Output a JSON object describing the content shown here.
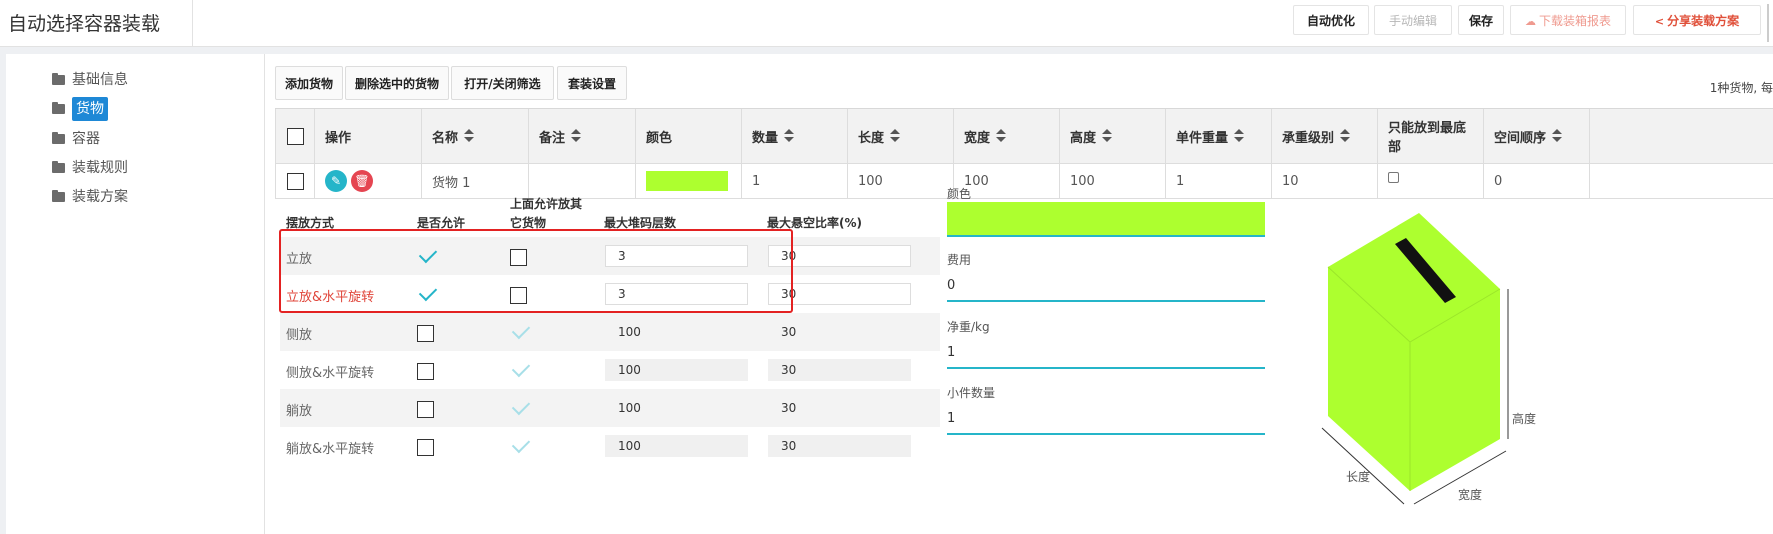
{
  "app_title": "自动选择容器装载",
  "toolbar": {
    "auto_optimize": "自动优化",
    "manual_edit": "手动编辑",
    "save": "保存",
    "download_report": "下载装箱报表",
    "share_plan": "分享装载方案"
  },
  "sidebar": {
    "items": [
      {
        "label": "基础信息"
      },
      {
        "label": "货物"
      },
      {
        "label": "容器"
      },
      {
        "label": "装载规则"
      },
      {
        "label": "装载方案"
      }
    ]
  },
  "actions": {
    "add_cargo": "添加货物",
    "delete_selected": "删除选中的货物",
    "toggle_filter": "打开/关闭筛选",
    "packing_settings": "套装设置"
  },
  "summary": "1种货物, 每",
  "table": {
    "headers": [
      "操作",
      "名称",
      "备注",
      "颜色",
      "数量",
      "长度",
      "宽度",
      "高度",
      "单件重量",
      "承重级别",
      "只能放到最底部",
      "空间顺序"
    ],
    "row": {
      "name": "货物 1",
      "note": "",
      "color": "#adff2f",
      "quantity": "1",
      "length": "100",
      "width": "100",
      "height": "100",
      "unit_weight": "1",
      "load_level": "10",
      "bottom_only": false,
      "space_order": "0"
    }
  },
  "placement": {
    "headers": {
      "mode": "摆放方式",
      "allowed": "是否允许",
      "stack_top_line1": "上面允许放其",
      "stack_top_line2": "它货物",
      "max_layers": "最大堆码层数",
      "max_overhang": "最大悬空比率(%)"
    },
    "rows": [
      {
        "label": "立放",
        "allowed": true,
        "stack_on_top": false,
        "max_layers": "3",
        "overhang": "30",
        "highlight": false
      },
      {
        "label": "立放&水平旋转",
        "allowed": true,
        "stack_on_top": false,
        "max_layers": "3",
        "overhang": "30",
        "highlight": true
      },
      {
        "label": "侧放",
        "allowed": false,
        "stack_on_top": true,
        "max_layers": "100",
        "overhang": "30",
        "highlight": false
      },
      {
        "label": "侧放&水平旋转",
        "allowed": false,
        "stack_on_top": true,
        "max_layers": "100",
        "overhang": "30",
        "highlight": false
      },
      {
        "label": "躺放",
        "allowed": false,
        "stack_on_top": true,
        "max_layers": "100",
        "overhang": "30",
        "highlight": false
      },
      {
        "label": "躺放&水平旋转",
        "allowed": false,
        "stack_on_top": true,
        "max_layers": "100",
        "overhang": "30",
        "highlight": false
      }
    ]
  },
  "details": {
    "color_label": "颜色",
    "color_value": "#adff2f",
    "cost_label": "费用",
    "cost_value": "0",
    "net_weight_label": "净重/kg",
    "net_weight_value": "1",
    "small_count_label": "小件数量",
    "small_count_value": "1"
  },
  "box_preview": {
    "height_label": "高度",
    "length_label": "长度",
    "width_label": "宽度",
    "face_color": "#adff2f"
  }
}
